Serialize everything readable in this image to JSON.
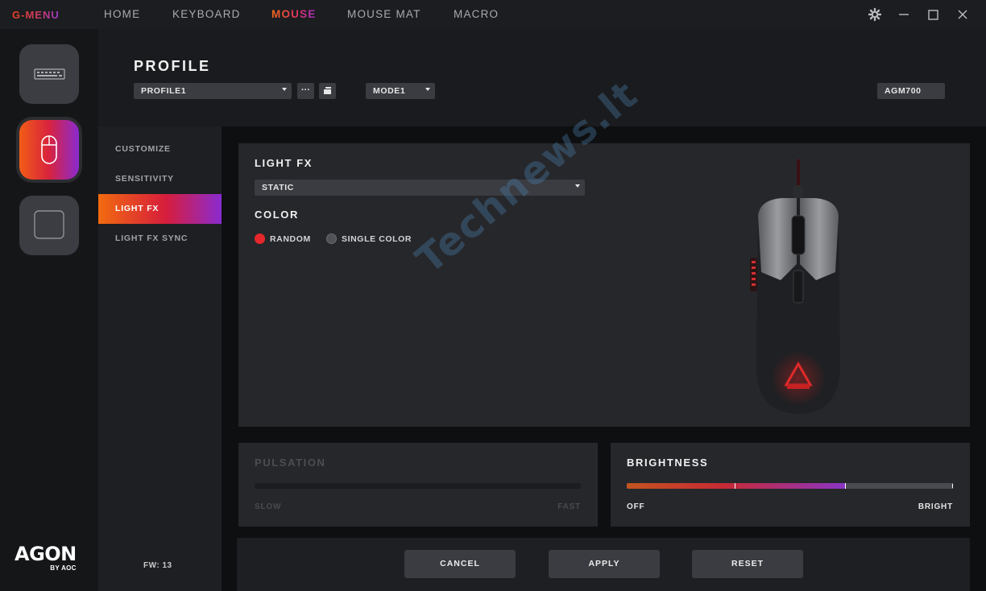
{
  "app": {
    "brand": "G-MENU",
    "nav": [
      {
        "label": "HOME"
      },
      {
        "label": "KEYBOARD"
      },
      {
        "label": "MOUSE"
      },
      {
        "label": "MOUSE MAT"
      },
      {
        "label": "MACRO"
      }
    ],
    "active_nav": "MOUSE"
  },
  "rail": {
    "devices": [
      "keyboard-icon",
      "mouse-icon",
      "mousepad-icon"
    ],
    "active_device": "mouse-icon",
    "logo_main": "AGON",
    "logo_sub": "BY AOC"
  },
  "header": {
    "title": "PROFILE",
    "profile_select": "PROFILE1",
    "mode_select": "MODE1",
    "device_model": "AGM700"
  },
  "sidemenu": {
    "items": [
      "CUSTOMIZE",
      "SENSITIVITY",
      "LIGHT FX",
      "LIGHT FX SYNC"
    ],
    "active": "LIGHT FX",
    "fw": "FW: 13"
  },
  "lightfx": {
    "title": "LIGHT FX",
    "effect_select": "STATIC",
    "color_title": "COLOR",
    "options": [
      {
        "label": "RANDOM",
        "selected": true
      },
      {
        "label": "SINGLE COLOR",
        "selected": false
      }
    ]
  },
  "pulsation": {
    "title": "PULSATION",
    "min_label": "SLOW",
    "max_label": "FAST",
    "enabled": false
  },
  "brightness": {
    "title": "BRIGHTNESS",
    "min_label": "OFF",
    "max_label": "BRIGHT",
    "level": 0.67
  },
  "actions": {
    "cancel": "CANCEL",
    "apply": "APPLY",
    "reset": "RESET"
  },
  "colors": {
    "accent_orange": "#f26b10",
    "accent_red": "#d61d3c",
    "accent_purple": "#8a2bd0",
    "radio_selected": "#e5272c"
  }
}
